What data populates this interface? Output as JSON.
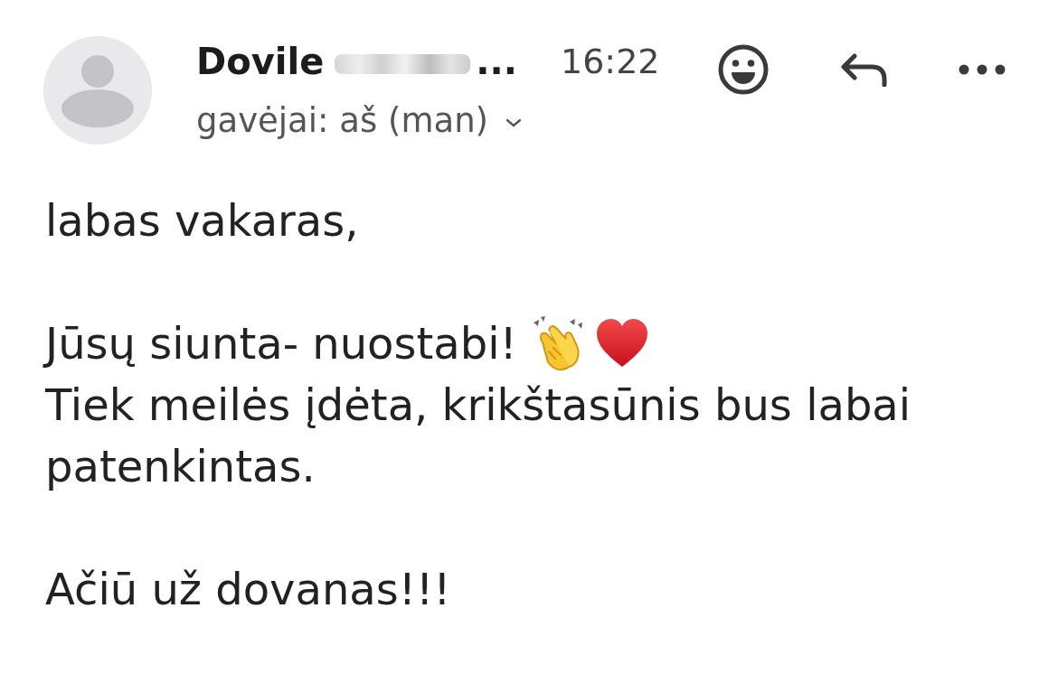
{
  "message_header": {
    "sender": {
      "name": "Dovile",
      "redacted": true,
      "ellipsis": "..."
    },
    "time": "16:22",
    "recipients": "gavėjai: aš (man)",
    "actions": [
      {
        "kind": "emoji-reaction"
      },
      {
        "kind": "reply"
      },
      {
        "kind": "more"
      }
    ]
  },
  "body": {
    "paragraphs": [
      {
        "lines": [
          {
            "text": "labas vakaras,"
          }
        ]
      },
      {
        "lines": [
          {
            "text": "Jūsų siunta- nuostabi!",
            "emojis": [
              {
                "kind": "clapping-hands"
              },
              {
                "kind": "heart"
              }
            ]
          },
          {
            "text": "Tiek meilės įdėta, krikštasūnis bus labai patenkintas."
          }
        ]
      },
      {
        "lines": [
          {
            "text": "Ačiū už dovanas!!!"
          }
        ]
      }
    ]
  }
}
